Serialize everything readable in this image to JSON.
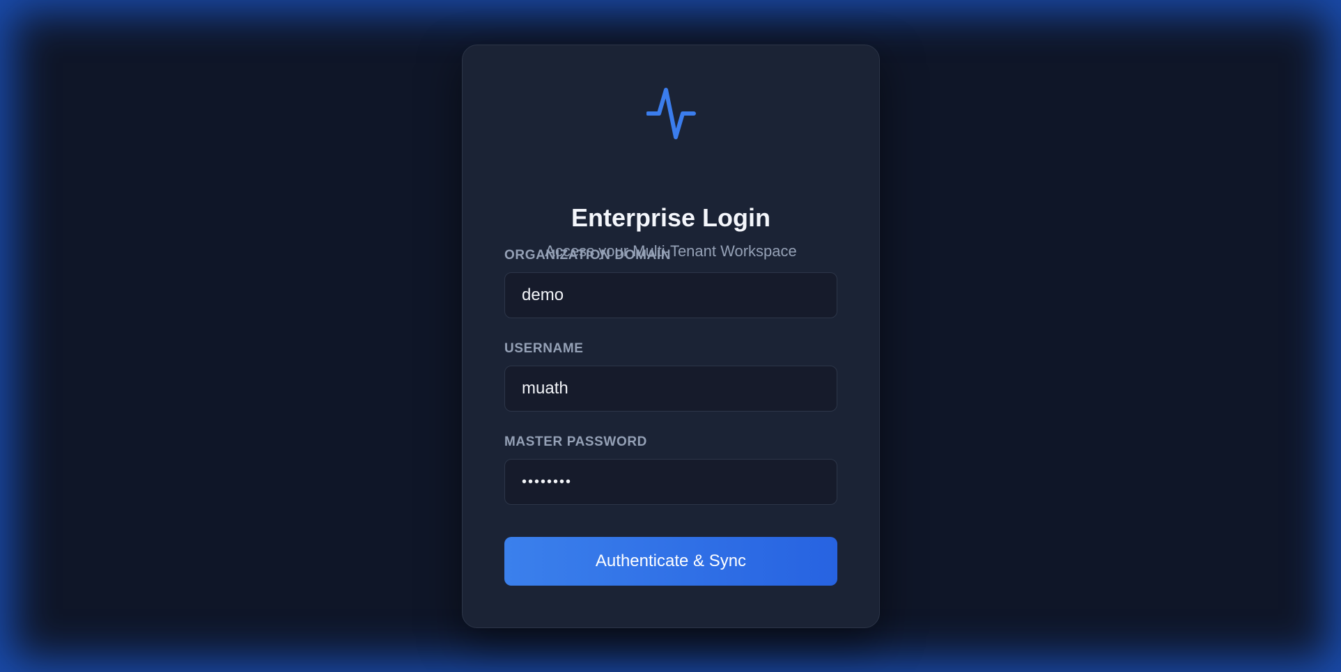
{
  "colors": {
    "background": "#0f1628",
    "card": "#1b2335",
    "accent": "#3b7ded",
    "label": "#95a1b6"
  },
  "header": {
    "logo_icon": "pulse-icon",
    "title": "Enterprise Login",
    "subtitle": "Access your Multi-Tenant Workspace"
  },
  "form": {
    "domain": {
      "label": "ORGANIZATION DOMAIN",
      "value": "demo"
    },
    "username": {
      "label": "USERNAME",
      "value": "muath"
    },
    "password": {
      "label": "MASTER PASSWORD",
      "value": "••••••••"
    },
    "submit_label": "Authenticate & Sync"
  }
}
